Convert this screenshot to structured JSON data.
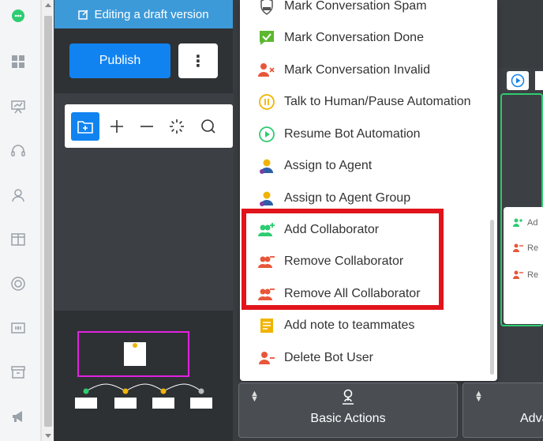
{
  "banner": {
    "text": "Editing a draft version"
  },
  "header": {
    "publish_label": "Publish",
    "more_label": "⋮"
  },
  "menu": {
    "items": [
      {
        "label": "Mark Conversation Spam",
        "icon": "spam-icon"
      },
      {
        "label": "Mark Conversation Done",
        "icon": "check-chat-icon"
      },
      {
        "label": "Mark Conversation Invalid",
        "icon": "user-x-icon"
      },
      {
        "label": "Talk to Human/Pause Automation",
        "icon": "pause-icon"
      },
      {
        "label": "Resume Bot Automation",
        "icon": "play-icon"
      },
      {
        "label": "Assign to Agent",
        "icon": "agent-icon"
      },
      {
        "label": "Assign to Agent Group",
        "icon": "agent-group-icon"
      },
      {
        "label": "Add Collaborator",
        "icon": "add-collaborator-icon"
      },
      {
        "label": "Remove Collaborator",
        "icon": "remove-collaborator-icon"
      },
      {
        "label": "Remove All Collaborator",
        "icon": "remove-all-collaborator-icon"
      },
      {
        "label": "Add note to teammates",
        "icon": "note-icon"
      },
      {
        "label": "Delete Bot User",
        "icon": "delete-user-icon"
      }
    ]
  },
  "node_preview": {
    "items": [
      "Ad",
      "Re",
      "Re"
    ]
  },
  "tabs": {
    "basic_label": "Basic Actions",
    "advanced_label": "Adva"
  },
  "colors": {
    "accent": "#1183f1",
    "highlight": "#e1141b",
    "green": "#2ecc71",
    "orange": "#e8563a"
  }
}
